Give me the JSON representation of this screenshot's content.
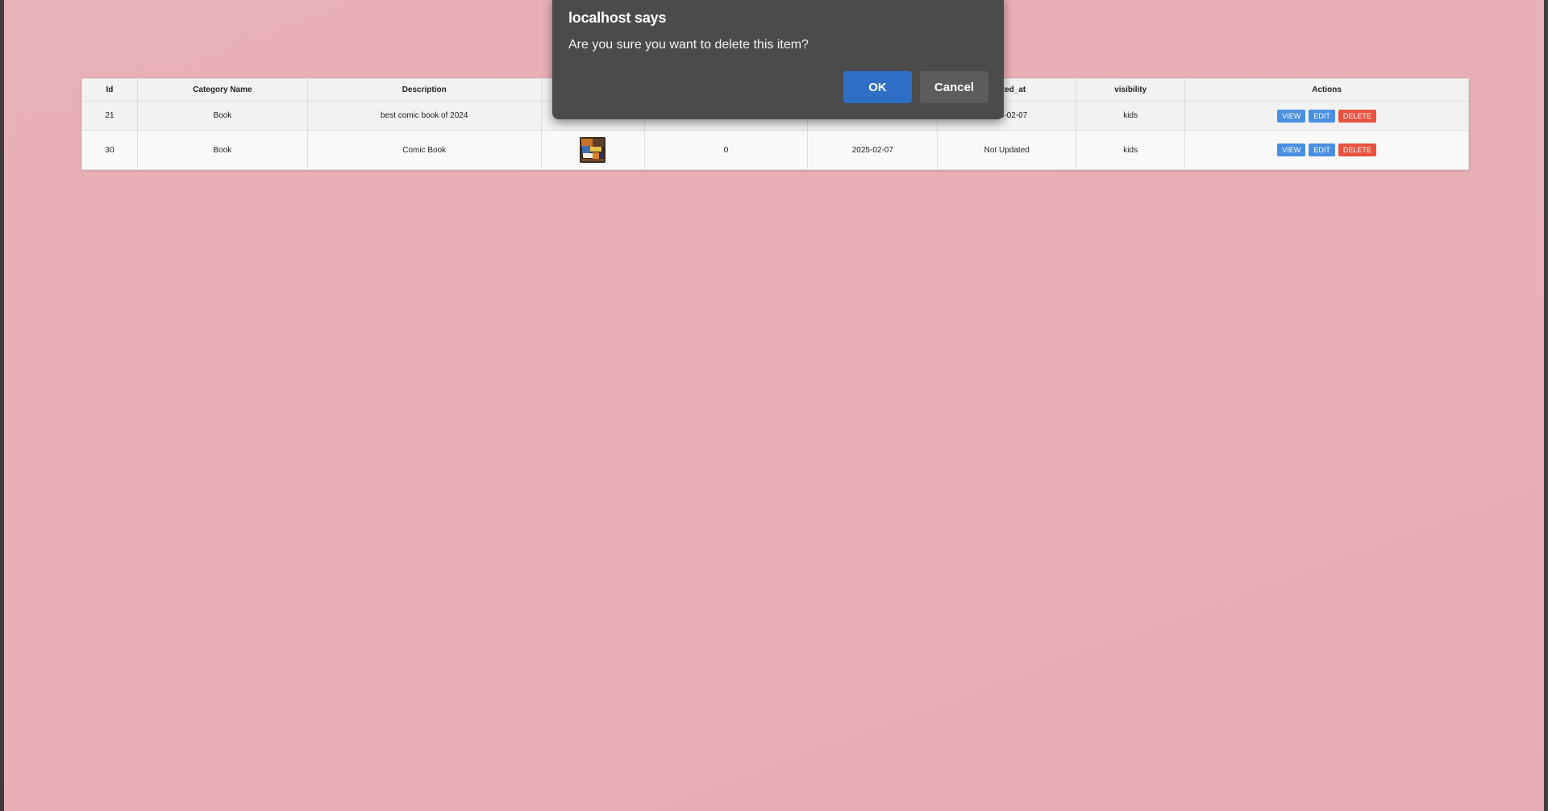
{
  "table": {
    "headers": [
      "Id",
      "Category Name",
      "Description",
      "",
      "",
      "",
      "updated_at",
      "visibility",
      "Actions"
    ],
    "rows": [
      {
        "id": "21",
        "category": "Book",
        "description": "best comic book of 2024",
        "count": "",
        "created": "",
        "updated": "25-02-07",
        "visibility": "kids"
      },
      {
        "id": "30",
        "category": "Book",
        "description": "Comic Book",
        "count": "0",
        "created": "2025-02-07",
        "updated": "Not Updated",
        "visibility": "kids"
      }
    ],
    "actions": {
      "view": "VIEW",
      "edit": "EDIT",
      "delete": "DELETE"
    }
  },
  "dialog": {
    "title": "localhost says",
    "message": "Are you sure you want to delete this item?",
    "ok": "OK",
    "cancel": "Cancel"
  },
  "colors": {
    "page_background": "#e8aeb5",
    "view_button": "#4a90e2",
    "edit_button": "#4a90e2",
    "delete_button": "#e8533f",
    "dialog_background": "#4b4b4b",
    "ok_button": "#2f6ec5"
  }
}
